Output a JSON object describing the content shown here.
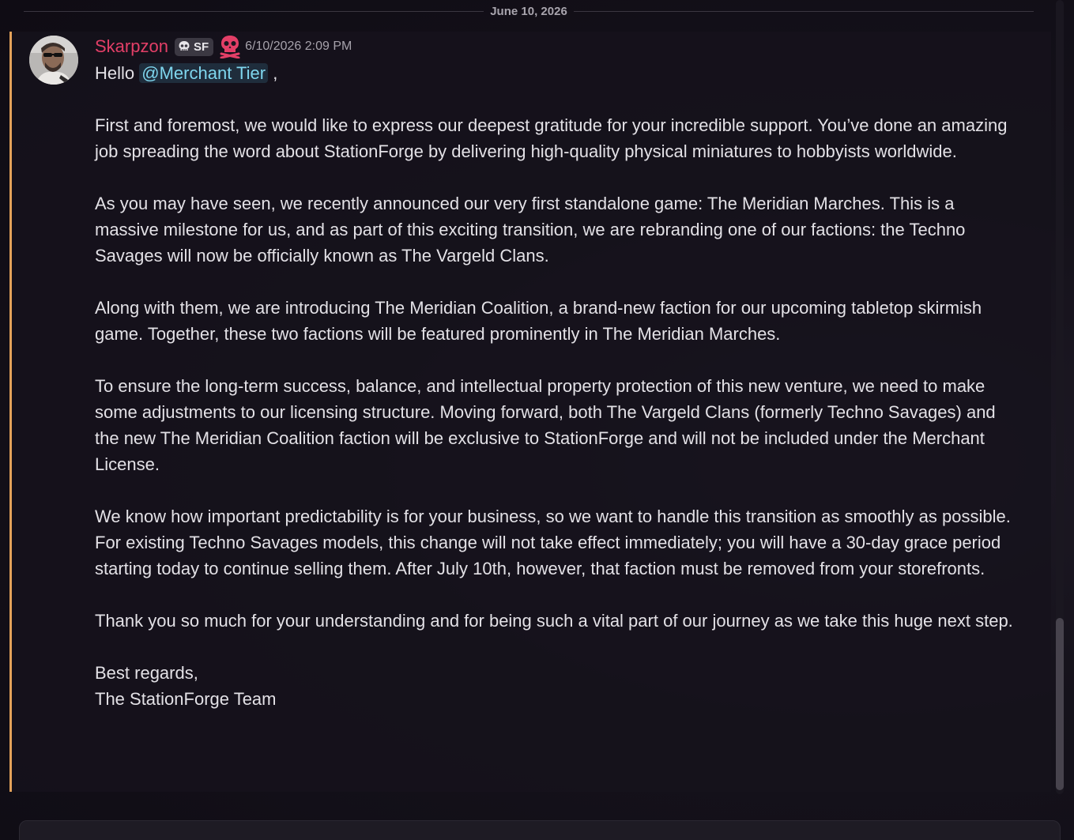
{
  "divider": {
    "date": "June 10, 2026"
  },
  "message": {
    "author": "Skarpzon",
    "tag": "SF",
    "timestamp": "6/10/2026 2:09 PM",
    "greeting": "Hello",
    "mention": "@Merchant Tier",
    "greeting_suffix": " ,",
    "paragraphs": [
      "First and foremost, we would like to express our deepest gratitude for your incredible support. You’ve done an amazing job spreading the word about StationForge by delivering high-quality physical miniatures to hobbyists worldwide.",
      "As you may have seen, we recently announced our very first standalone game: The Meridian Marches. This is a massive milestone for us, and as part of this exciting transition, we are rebranding one of our factions: the Techno Savages will now be officially known as The Vargeld Clans.",
      "Along with them, we are introducing The Meridian Coalition, a brand-new faction for our upcoming tabletop skirmish game. Together, these two factions will be featured prominently in The Meridian Marches.",
      "To ensure the long-term success, balance, and intellectual property protection of this new venture, we need to make some adjustments to our licensing structure. Moving forward, both The Vargeld Clans (formerly Techno Savages) and the new The Meridian Coalition faction will be exclusive to StationForge and will not be included under the Merchant License.",
      "We know how important predictability is for your business, so we want to handle this transition as smoothly as possible. For existing Techno Savages models, this change will not take effect immediately; you will have a 30-day grace period starting today to continue selling them. After July 10th, however, that faction must be removed from your storefronts.",
      "Thank you so much for your understanding and for being such a vital part of our journey as we take this huge next step."
    ],
    "signoff": "Best regards,",
    "signature": "The StationForge Team"
  },
  "colors": {
    "username": "#e33f67",
    "mention": "#7fd6ee",
    "highlight_bar": "#e3a25a",
    "role_icon": "#e33f67"
  },
  "icons": {
    "tag_icon": "skull-icon",
    "role_icon": "skull-icon"
  }
}
